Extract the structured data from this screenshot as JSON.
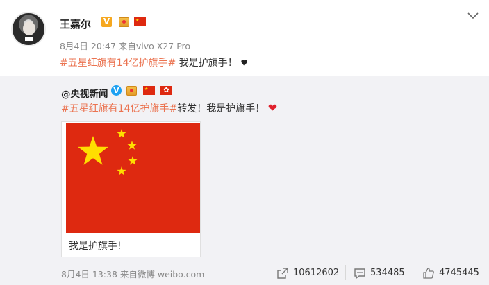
{
  "post": {
    "author": "王嘉尔",
    "verified_badge": "V",
    "date": "8月4日 20:47",
    "source": "来自vivo X27 Pro",
    "hashtag": "#五星红旗有14亿护旗手#",
    "text": " 我是护旗手！",
    "emoji_icon": "black-heart"
  },
  "repost": {
    "author": "@央视新闻",
    "verified_badge": "V",
    "hashtag": "#五星红旗有14亿护旗手#",
    "text": "转发！我是护旗手！",
    "emoji_icon": "red-heart",
    "card_caption": "我是护旗手!",
    "date": "8月4日 13:38",
    "source": "来自微博 weibo.com",
    "stats": {
      "reposts": "10612602",
      "comments": "534485",
      "likes": "4745445"
    }
  },
  "colors": {
    "hashtag": "#eb7350",
    "flag_red": "#de2910",
    "flag_star": "#ffde00",
    "repost_bg": "#f2f2f5",
    "verified_blue": "#1da1f2",
    "verified_orange": "#f6a820"
  }
}
